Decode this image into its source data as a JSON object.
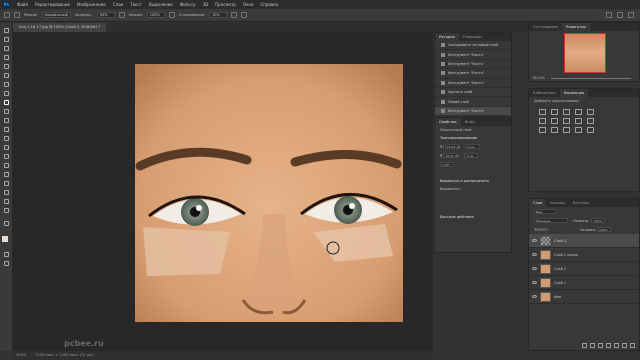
{
  "menubar": {
    "app_badge": "Ps",
    "items": [
      "Файл",
      "Редактирование",
      "Изображение",
      "Слои",
      "Текст",
      "Выделение",
      "Фильтр",
      "3D",
      "Просмотр",
      "Окно",
      "Справка"
    ]
  },
  "options": {
    "mode_label": "Режим:",
    "mode_value": "Нормальный",
    "opacity_label": "Непрозр.:",
    "opacity_value": "90%",
    "flow_label": "Нажим:",
    "flow_value": "100%",
    "smooth_label": "Сглаживание:",
    "smooth_value": "10%"
  },
  "document": {
    "tab_title": "imp-1-16-17.jpg @ 100% (Слой 2, RGB/8#) *",
    "zoom": "100%",
    "doc_size": "1200 пикс × 1200 пикс (72 ppi)"
  },
  "watermark": "pcbee.ru",
  "history": {
    "tabs": [
      "История",
      "Операции"
    ],
    "items": [
      "Скопировать на новый слой",
      "Инструмент \"Кисть\"",
      "Инструмент \"Кисть\"",
      "Инструмент \"Кисть\"",
      "Инструмент \"Кисть\"",
      "Удалить слой",
      "Новый слой",
      "Инструмент \"Кисть\""
    ]
  },
  "properties": {
    "tabs": [
      "Свойства",
      "Инфо"
    ],
    "subtitle": "Пиксельный слой",
    "transform_label": "Трансформирование",
    "w_label": "Ш",
    "w_value": "16,93 см",
    "h_label": "В",
    "h_value": "16,93 см",
    "x_value": "0 см",
    "y_value": "0 см",
    "angle_value": "0,00°",
    "align_label": "Выровнять и распределить",
    "align_sub": "Выровнять:",
    "quick_label": "Быстрые действия"
  },
  "navigator": {
    "tabs": [
      "Гистограмма",
      "Навигатор"
    ],
    "zoom": "100,4%"
  },
  "libraries": {
    "tabs": [
      "Библиотеки",
      "Коррекция"
    ],
    "subtitle": "Добавить корректировку"
  },
  "layers": {
    "tabs": [
      "Слои",
      "Каналы",
      "Контуры"
    ],
    "filter_label": "Вид",
    "blend_value": "Обычные",
    "opacity_label": "Непрозр.:",
    "opacity_value": "100%",
    "lock_label": "Закреп.:",
    "fill_label": "Заливка:",
    "fill_value": "100%",
    "items": [
      "Слой 3",
      "Слой 1 копия",
      "Слой 2",
      "Слой 1",
      "Фон"
    ]
  }
}
